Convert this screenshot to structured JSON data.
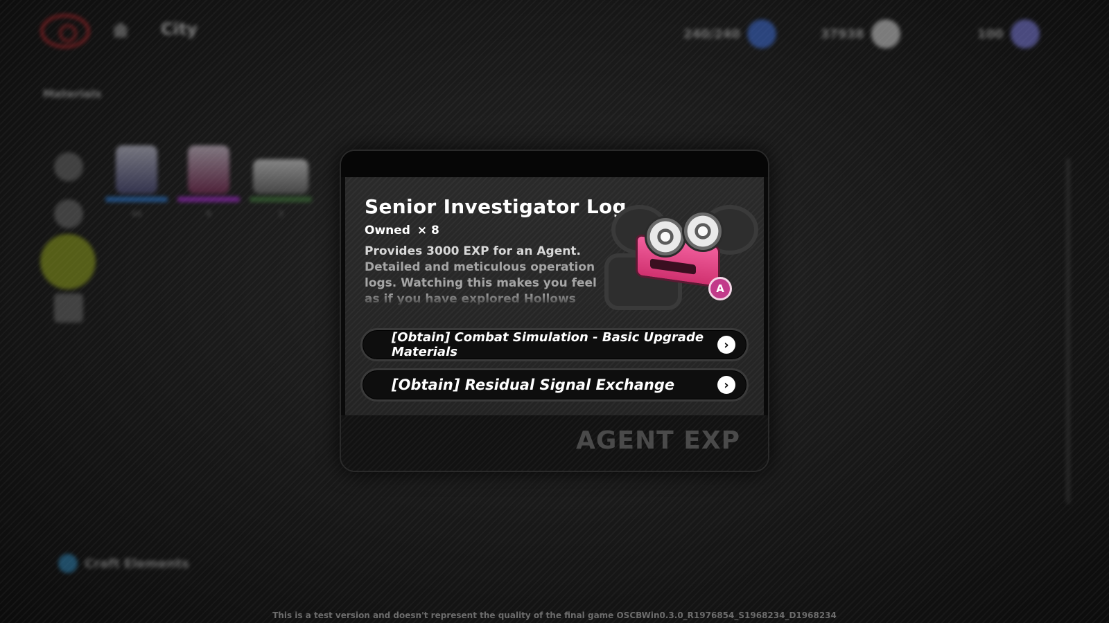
{
  "background": {
    "location": "City",
    "currencies": [
      {
        "amount": "240/240",
        "icon": "battery-charge-icon",
        "color": "#3d6bd1"
      },
      {
        "amount": "37938",
        "icon": "denny-coin-icon",
        "color": "#d0d0d0"
      },
      {
        "amount": "100",
        "icon": "polychrome-icon",
        "color": "#7a7ad8"
      }
    ],
    "section_label": "Materials",
    "item_counts": [
      "44",
      "9",
      "3"
    ],
    "craft_label": "Craft Elements"
  },
  "dialog": {
    "title": "Senior Investigator Log",
    "owned_label": "Owned",
    "owned_count": "× 8",
    "description_line1": "Provides 3000 EXP for an Agent.",
    "description_rest": "Detailed and meticulous operation logs. Watching this makes you feel as if you have explored Hollows yourself.",
    "rank": "A",
    "item_icon": "cassette-tape-icon",
    "accent_color": "#e8458a",
    "obtain_options": [
      {
        "label": "[Obtain] Combat Simulation - Basic Upgrade Materials"
      },
      {
        "label": "[Obtain] Residual Signal Exchange"
      }
    ],
    "category": "AGENT EXP"
  },
  "footer": {
    "note": "This is a test version and doesn't represent the quality of the final game OSCBWin0.3.0_R1976854_S1968234_D1968234"
  }
}
